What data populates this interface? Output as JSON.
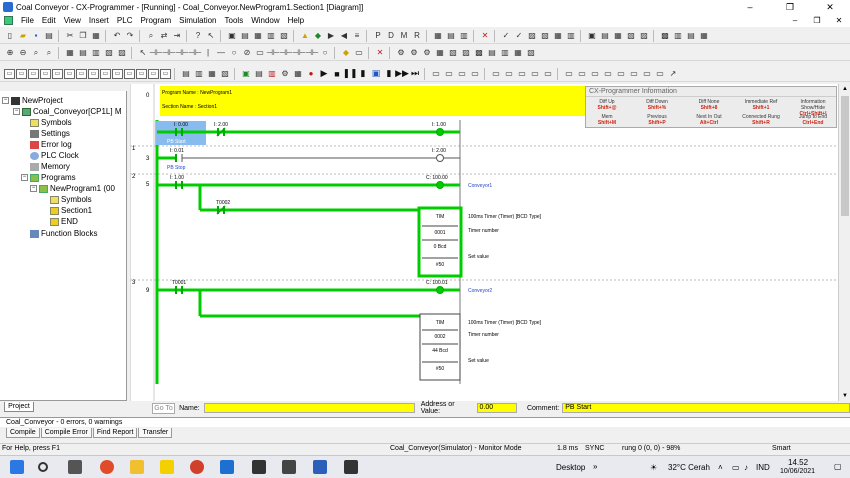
{
  "window": {
    "title": "Coal Conveyor - CX-Programmer - [Running] - Coal_Conveyor.NewProgram1.Section1 [Diagram]]",
    "minimize": "–",
    "maximize": "❐",
    "close": "✕"
  },
  "menu": {
    "items": [
      "File",
      "Edit",
      "View",
      "Insert",
      "PLC",
      "Program",
      "Simulation",
      "Tools",
      "Window",
      "Help"
    ],
    "right_controls": [
      "–",
      "❐",
      "✕"
    ]
  },
  "tree": {
    "root": "NewProject",
    "plc": "Coal_Conveyor[CP1L] M",
    "items": [
      "Symbols",
      "Settings",
      "Error log",
      "PLC Clock",
      "Memory",
      "Programs"
    ],
    "program": "NewProgram1 (00",
    "program_items": [
      "Symbols",
      "Section1",
      "END"
    ],
    "function_blocks": "Function Blocks",
    "tab_label": "Project"
  },
  "diagram": {
    "program_name_label": "Program Name : NewProgram1",
    "section_name_label": "Section Name : Section1",
    "rungs": [
      {
        "rung": "0",
        "step": "0",
        "contact1": "I: 0.00",
        "contact1_comment": "PB Start",
        "contact2": "I: 2.00",
        "coil": "I: 1.00"
      },
      {
        "rung": "1",
        "step": "3",
        "contact1": "I: 0.01",
        "contact1_comment": "PB Stop",
        "coil": "I: 2.00"
      },
      {
        "rung": "2",
        "step": "5",
        "contact1": "I: 1.00",
        "coil": "C: 100.00",
        "coil_comment": "Conveyor1",
        "branch_contact": "T0002",
        "tim": {
          "head": "TIM",
          "number": "0001",
          "sv": "0 Bcd",
          "set": "#50"
        },
        "tim_desc": "100ms Timer (Timer) [BCD Type]",
        "tim_number_label": "Timer number",
        "tim_set_label": "Set value"
      },
      {
        "rung": "3",
        "step": "9",
        "contact1": "T0001",
        "coil": "C: 100.01",
        "coil_comment": "Conveyor2",
        "tim": {
          "head": "TIM",
          "number": "0002",
          "sv": "44 Bcd",
          "set": "#50"
        },
        "tim_desc": "100ms Timer (Timer) [BCD Type]",
        "tim_number_label": "Timer number",
        "tim_set_label": "Set value"
      }
    ]
  },
  "info_panel": {
    "title": "CX-Programmer Information",
    "cells": [
      {
        "name": "Diff Up",
        "key": "Shift+@"
      },
      {
        "name": "Diff Down",
        "key": "Shift+%"
      },
      {
        "name": "Diff None",
        "key": "Shift+8"
      },
      {
        "name": "Immediate Ref",
        "key": "Shift+1"
      },
      {
        "name": "Information Show/Hide",
        "key": "Ctrl+Shift+I"
      },
      {
        "name": "Mem",
        "key": "Shift+M"
      },
      {
        "name": "Previous",
        "key": "Shift+P"
      },
      {
        "name": "Next In Out",
        "key": "Alt+Ctrl"
      },
      {
        "name": "Connected Rung",
        "key": "Shift+R"
      },
      {
        "name": "Jump to End",
        "key": "Ctrl+End"
      }
    ]
  },
  "findbar": {
    "goto": "Go To",
    "name_label": "Name:",
    "address_label": "Address or Value:",
    "address_value": "0.00",
    "comment_label": "Comment:",
    "comment_value": "PB Start"
  },
  "output": {
    "line": "Coal_Conveyor - 0 errors, 0 warnings",
    "tabs": [
      "Compile",
      "Compile Error",
      "Find Report",
      "Transfer"
    ]
  },
  "status": {
    "help": "For Help, press F1",
    "mode": "Coal_Conveyor(Simulator) - Monitor Mode",
    "scan": "1.8 ms",
    "sync": "SYNC",
    "rung": "rung 0 (0, 0) - 98%",
    "smart": "Smart"
  },
  "taskbar": {
    "desktop": "Desktop",
    "weather": "32°C Cerah",
    "lang": "IND",
    "time": "14.52",
    "date": "10/06/2021"
  },
  "colors": {
    "accent_green": "#00cc00",
    "highlight_yellow": "#ffff00",
    "contact_selected": "#88bbee",
    "comment_blue": "#2244cc"
  }
}
